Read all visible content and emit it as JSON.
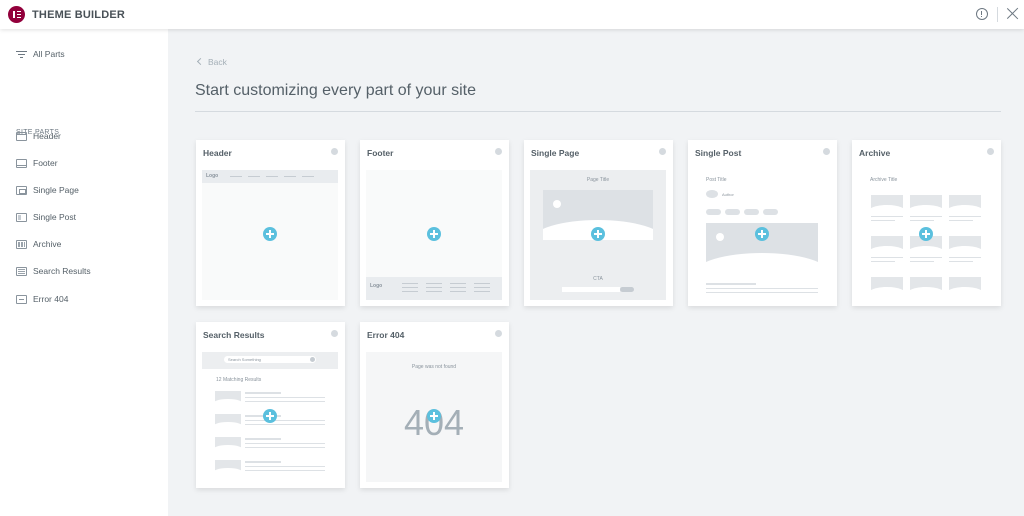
{
  "app": {
    "title": "THEME BUILDER"
  },
  "sidebar": {
    "all_parts": "All Parts",
    "heading": "SITE PARTS",
    "items": [
      {
        "label": "Header",
        "icon": "header-icon"
      },
      {
        "label": "Footer",
        "icon": "footer-icon"
      },
      {
        "label": "Single Page",
        "icon": "single-page-icon"
      },
      {
        "label": "Single Post",
        "icon": "single-post-icon"
      },
      {
        "label": "Archive",
        "icon": "archive-icon"
      },
      {
        "label": "Search Results",
        "icon": "search-results-icon"
      },
      {
        "label": "Error 404",
        "icon": "error-404-icon"
      }
    ]
  },
  "main": {
    "back_label": "Back",
    "title": "Start customizing every part of your site",
    "cards": [
      {
        "title": "Header",
        "thumb": {
          "logo": "Logo"
        }
      },
      {
        "title": "Footer",
        "thumb": {
          "logo": "Logo"
        }
      },
      {
        "title": "Single Page",
        "thumb": {
          "page_title": "Page Title",
          "cta": "CTA"
        }
      },
      {
        "title": "Single Post",
        "thumb": {
          "post_title": "Post Title",
          "author": "Author"
        }
      },
      {
        "title": "Archive",
        "thumb": {
          "archive_title": "Archive Title"
        }
      },
      {
        "title": "Search Results",
        "thumb": {
          "search_placeholder": "Search Something",
          "results": "12 Matching Results"
        }
      },
      {
        "title": "Error 404",
        "thumb": {
          "message": "Page was not found",
          "code": "404"
        }
      }
    ]
  },
  "colors": {
    "brand": "#92003b",
    "accent": "#5bc0de",
    "background": "#f1f3f5"
  }
}
